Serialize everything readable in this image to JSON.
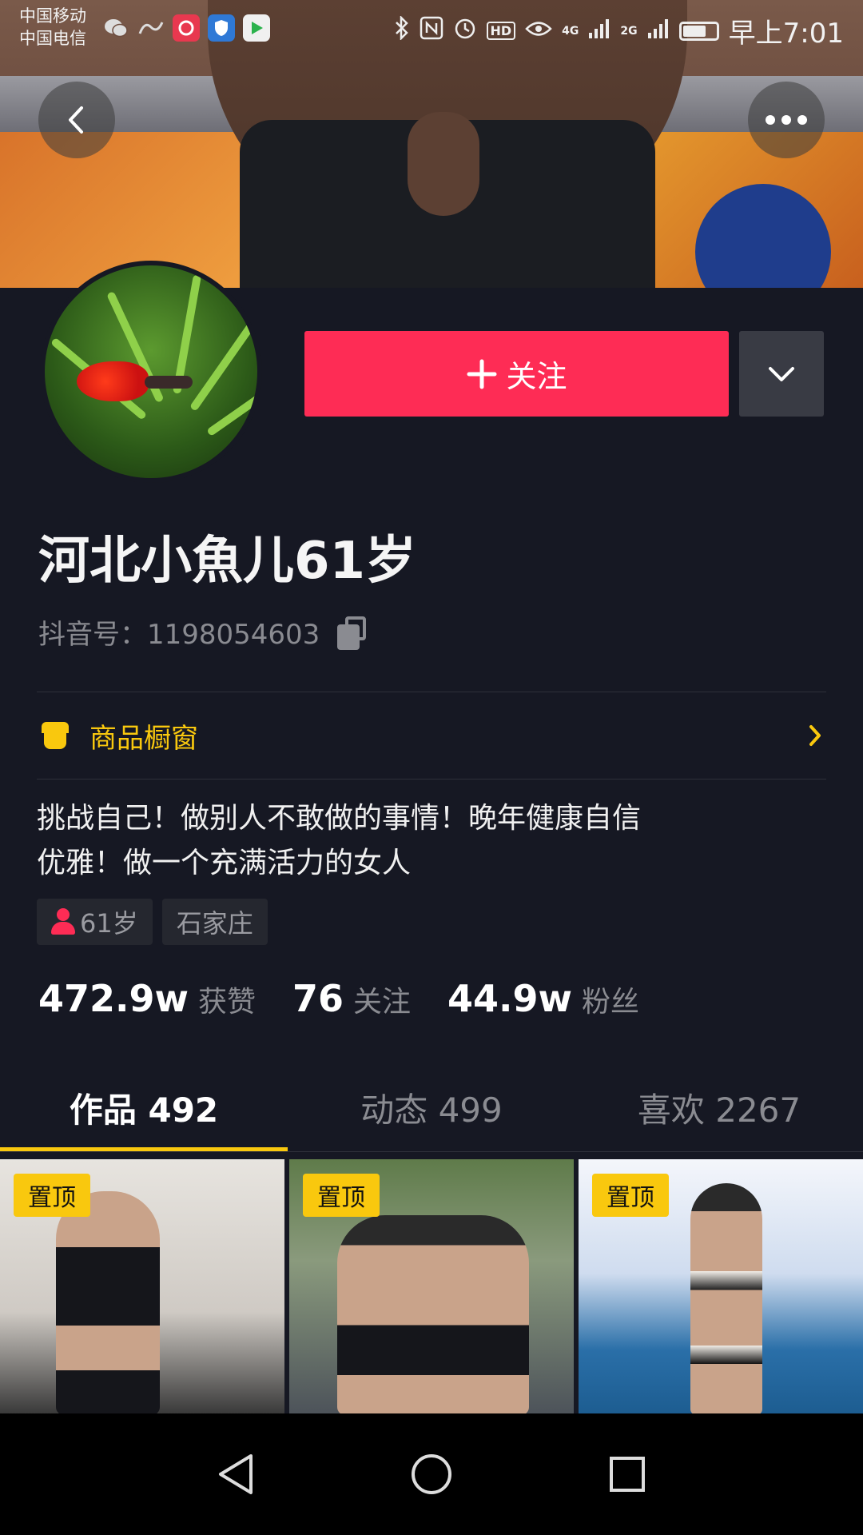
{
  "status_bar": {
    "carrier1": "中国移动",
    "carrier2": "中国电信",
    "time": "早上7:01",
    "network1": "4G",
    "network2": "2G",
    "hd": "HD"
  },
  "profile": {
    "name": "河北小魚儿61岁",
    "douyin_id": "抖音号：1198054603",
    "follow_label": "关注",
    "shop_label": "商品橱窗",
    "bio_line1": "挑战自己！做别人不敢做的事情！晚年健康自信",
    "bio_line2": "优雅！做一个充满活力的女人",
    "tags": {
      "age": "61岁",
      "city": "石家庄"
    }
  },
  "stats": [
    {
      "num": "472.9w",
      "label": "获赞"
    },
    {
      "num": "76",
      "label": "关注"
    },
    {
      "num": "44.9w",
      "label": "粉丝"
    }
  ],
  "tabs": [
    {
      "label": "作品 492",
      "active": true
    },
    {
      "label": "动态 499",
      "active": false
    },
    {
      "label": "喜欢 2267",
      "active": false
    }
  ],
  "thumbnails": [
    {
      "badge": "置顶"
    },
    {
      "badge": "置顶"
    },
    {
      "badge": "置顶"
    }
  ],
  "colors": {
    "background": "#161823",
    "follow_button": "#fe2c55",
    "accent_yellow": "#f9c80e"
  }
}
